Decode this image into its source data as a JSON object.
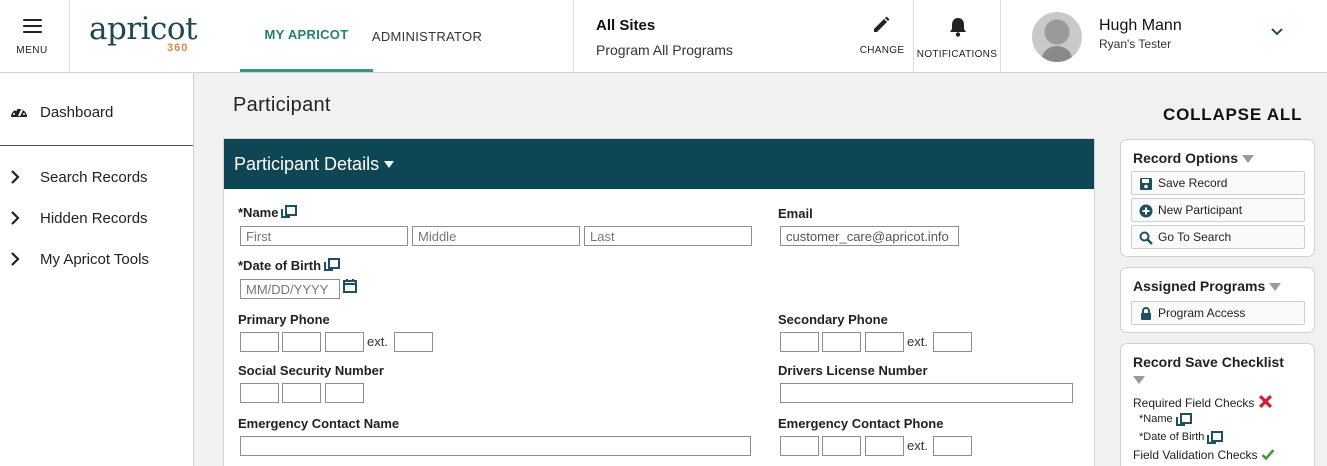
{
  "header": {
    "menu_label": "MENU",
    "logo_word": "apricot",
    "logo_number": "360",
    "tabs": [
      {
        "label": "MY APRICOT",
        "active": true
      },
      {
        "label": "ADMINISTRATOR",
        "active": false
      }
    ],
    "site": "All Sites",
    "program": "Program All Programs",
    "change_label": "CHANGE",
    "notifications_label": "NOTIFICATIONS",
    "user_name": "Hugh Mann",
    "user_role": "Ryan's Tester"
  },
  "sidebar": {
    "dashboard": "Dashboard",
    "items": [
      {
        "label": "Search Records"
      },
      {
        "label": "Hidden Records"
      },
      {
        "label": "My Apricot Tools"
      }
    ]
  },
  "main": {
    "page_title": "Participant",
    "section_title": "Participant Details",
    "fields": {
      "name_label": "*Name",
      "first_placeholder": "First",
      "middle_placeholder": "Middle",
      "last_placeholder": "Last",
      "email_label": "Email",
      "email_value": "customer_care@apricot.info",
      "dob_label": "*Date of Birth",
      "dob_placeholder": "MM/DD/YYYY",
      "primary_phone_label": "Primary Phone",
      "secondary_phone_label": "Secondary Phone",
      "ext_label": "ext.",
      "ssn_label": "Social Security Number",
      "drivers_license_label": "Drivers License Number",
      "emergency_name_label": "Emergency Contact Name",
      "emergency_phone_label": "Emergency Contact Phone"
    }
  },
  "right_panel": {
    "collapse_all": "COLLAPSE ALL",
    "record_options": {
      "title": "Record Options",
      "buttons": [
        "Save Record",
        "New Participant",
        "Go To Search"
      ]
    },
    "assigned_programs": {
      "title": "Assigned Programs",
      "button": "Program Access"
    },
    "checklist": {
      "title": "Record Save Checklist",
      "required_label": "Required Field Checks",
      "required_items": [
        "*Name",
        "*Date of Birth"
      ],
      "validation_label": "Field Validation Checks"
    }
  },
  "colors": {
    "brand_dark": "#0f4653",
    "brand_accent": "#2a9d87",
    "error": "#d0202a",
    "success": "#3f9a3a"
  }
}
